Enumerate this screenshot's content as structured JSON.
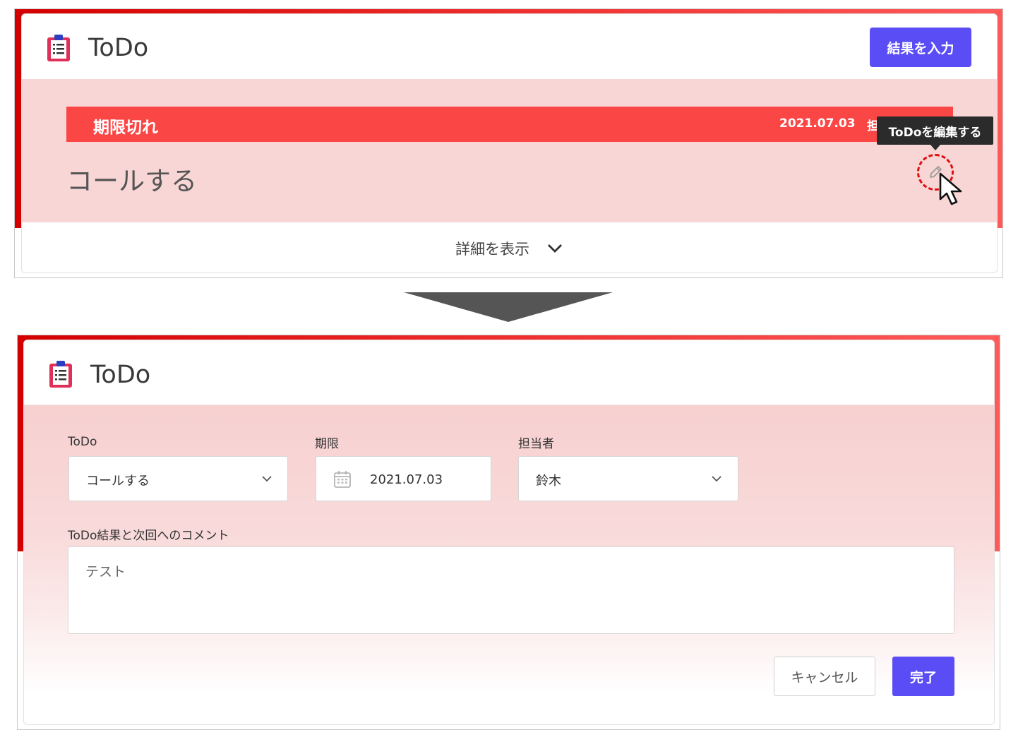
{
  "top": {
    "app_title": "ToDo",
    "result_button": "結果を入力",
    "status_label": "期限切れ",
    "due_date": "2021.07.03",
    "assignee_fragment": "担",
    "todo_text": "コールする",
    "tooltip": "ToDoを編集する",
    "details_label": "詳細を表示"
  },
  "bottom": {
    "app_title": "ToDo",
    "fields": {
      "todo_label": "ToDo",
      "todo_value": "コールする",
      "due_label": "期限",
      "due_value": "2021.07.03",
      "assignee_label": "担当者",
      "assignee_value": "鈴木",
      "comment_label": "ToDo結果と次回へのコメント",
      "comment_value": "テスト"
    },
    "cancel_button": "キャンセル",
    "done_button": "完了"
  },
  "colors": {
    "accent": "#5a4df5",
    "overdue": "#fb4646",
    "frame_red": "#e01010",
    "pink_bg": "#f9d6d6"
  },
  "icons": [
    "clipboard-icon",
    "pencil-icon",
    "cursor-icon",
    "chevron-down-icon",
    "calendar-icon"
  ]
}
